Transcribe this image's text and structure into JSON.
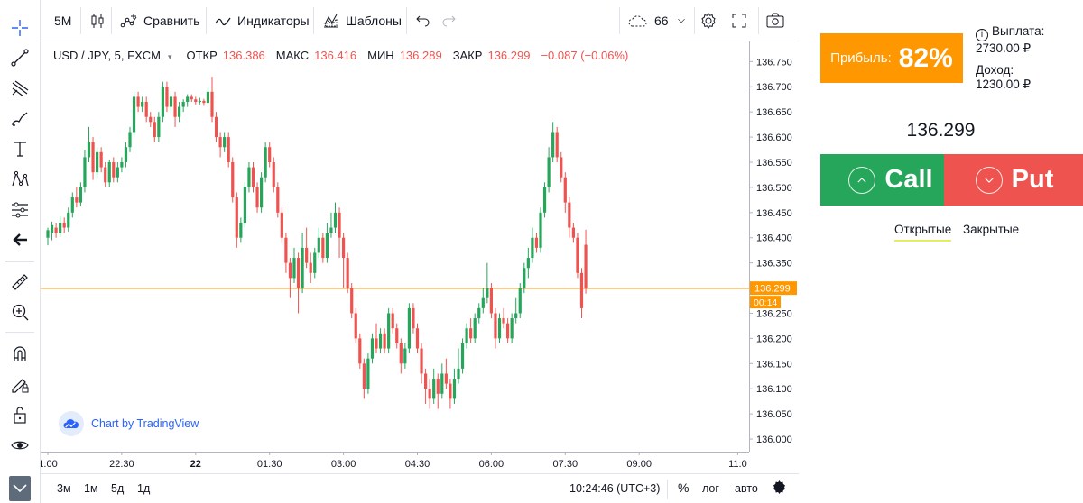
{
  "top_toolbar": {
    "interval": "5M",
    "compare_label": "Сравнить",
    "indicators_label": "Индикаторы",
    "templates_label": "Шаблоны",
    "weather_count": "66"
  },
  "legend": {
    "symbol": "USD / JPY, 5, FXCM",
    "open_label": "ОТКР",
    "open": "136.386",
    "high_label": "МАКС",
    "high": "136.416",
    "low_label": "МИН",
    "low": "136.289",
    "close_label": "ЗАКР",
    "close": "136.299",
    "change": "−0.087 (−0.06%)"
  },
  "price_label": {
    "price": "136.299",
    "countdown": "00:14"
  },
  "watermark": "Chart by TradingView",
  "bottom_bar": {
    "ranges": [
      "3м",
      "1м",
      "5д",
      "1д"
    ],
    "time": "10:24:46 (UTC+3)",
    "percent": "%",
    "log": "лог",
    "auto": "авто"
  },
  "right_panel": {
    "profit_label": "Прибыль:",
    "profit_value": "82%",
    "payout_label": "Выплата:",
    "payout_value": "2730.00 ₽",
    "income_label": "Доход:",
    "income_value": "1230.00 ₽",
    "current_price": "136.299",
    "call_label": "Call",
    "put_label": "Put",
    "tab_open": "Открытые",
    "tab_closed": "Закрытые"
  },
  "colors": {
    "up": "#26a65b",
    "down": "#ef5350",
    "accent": "#ff9800",
    "brand": "#2962ff"
  },
  "chart_data": {
    "type": "candlestick",
    "y_ticks": [
      "136.750",
      "136.700",
      "136.650",
      "136.600",
      "136.550",
      "136.500",
      "136.450",
      "136.400",
      "136.350",
      "136.300",
      "136.250",
      "136.200",
      "136.150",
      "136.100",
      "136.050",
      "136.000"
    ],
    "ylim": [
      135.975,
      136.79
    ],
    "x_ticks": [
      {
        "label": "1:00",
        "bold": false,
        "i": 0
      },
      {
        "label": "22:30",
        "bold": false,
        "i": 18
      },
      {
        "label": "22",
        "bold": true,
        "i": 36
      },
      {
        "label": "01:30",
        "bold": false,
        "i": 54
      },
      {
        "label": "03:00",
        "bold": false,
        "i": 72
      },
      {
        "label": "04:30",
        "bold": false,
        "i": 90
      },
      {
        "label": "06:00",
        "bold": false,
        "i": 108
      },
      {
        "label": "07:30",
        "bold": false,
        "i": 126
      },
      {
        "label": "09:00",
        "bold": false,
        "i": 144
      },
      {
        "label": "11:0",
        "bold": false,
        "i": 168
      }
    ],
    "current_price": 136.299,
    "candles": [
      [
        136.4,
        136.415,
        136.385,
        136.42
      ],
      [
        136.41,
        136.425,
        136.395,
        136.432
      ],
      [
        136.42,
        136.41,
        136.4,
        136.43
      ],
      [
        136.41,
        136.43,
        136.402,
        136.442
      ],
      [
        136.43,
        136.42,
        136.41,
        136.44
      ],
      [
        136.42,
        136.45,
        136.412,
        136.46
      ],
      [
        136.45,
        136.48,
        136.44,
        136.49
      ],
      [
        136.48,
        136.47,
        136.46,
        136.5
      ],
      [
        136.47,
        136.5,
        136.462,
        136.51
      ],
      [
        136.5,
        136.56,
        136.49,
        136.575
      ],
      [
        136.56,
        136.59,
        136.55,
        136.62
      ],
      [
        136.59,
        136.53,
        136.515,
        136.6
      ],
      [
        136.53,
        136.57,
        136.52,
        136.58
      ],
      [
        136.57,
        136.54,
        136.53,
        136.58
      ],
      [
        136.54,
        136.51,
        136.5,
        136.55
      ],
      [
        136.51,
        136.55,
        136.5,
        136.555
      ],
      [
        136.55,
        136.52,
        136.51,
        136.56
      ],
      [
        136.52,
        136.54,
        136.51,
        136.55
      ],
      [
        136.54,
        136.55,
        136.53,
        136.56
      ],
      [
        136.55,
        136.58,
        136.54,
        136.59
      ],
      [
        136.58,
        136.61,
        136.57,
        136.62
      ],
      [
        136.61,
        136.68,
        136.6,
        136.69
      ],
      [
        136.68,
        136.66,
        136.65,
        136.69
      ],
      [
        136.66,
        136.67,
        136.65,
        136.68
      ],
      [
        136.67,
        136.64,
        136.63,
        136.68
      ],
      [
        136.64,
        136.63,
        136.62,
        136.65
      ],
      [
        136.63,
        136.6,
        136.59,
        136.64
      ],
      [
        136.6,
        136.64,
        136.59,
        136.65
      ],
      [
        136.64,
        136.7,
        136.63,
        136.71
      ],
      [
        136.7,
        136.66,
        136.65,
        136.71
      ],
      [
        136.66,
        136.68,
        136.65,
        136.69
      ],
      [
        136.68,
        136.64,
        136.62,
        136.69
      ],
      [
        136.64,
        136.66,
        136.63,
        136.67
      ],
      [
        136.66,
        136.67,
        136.65,
        136.675
      ],
      [
        136.67,
        136.68,
        136.66,
        136.685
      ],
      [
        136.68,
        136.675,
        136.67,
        136.685
      ],
      [
        136.675,
        136.67,
        136.665,
        136.68
      ],
      [
        136.67,
        136.672,
        136.665,
        136.678
      ],
      [
        136.672,
        136.668,
        136.662,
        136.676
      ],
      [
        136.668,
        136.69,
        136.665,
        136.7
      ],
      [
        136.69,
        136.64,
        136.63,
        136.72
      ],
      [
        136.64,
        136.6,
        136.59,
        136.65
      ],
      [
        136.6,
        136.58,
        136.56,
        136.61
      ],
      [
        136.58,
        136.6,
        136.57,
        136.61
      ],
      [
        136.6,
        136.55,
        136.54,
        136.61
      ],
      [
        136.55,
        136.48,
        136.47,
        136.56
      ],
      [
        136.48,
        136.4,
        136.38,
        136.49
      ],
      [
        136.4,
        136.43,
        136.39,
        136.44
      ],
      [
        136.43,
        136.5,
        136.42,
        136.51
      ],
      [
        136.5,
        136.54,
        136.49,
        136.55
      ],
      [
        136.54,
        136.5,
        136.49,
        136.55
      ],
      [
        136.5,
        136.46,
        136.45,
        136.51
      ],
      [
        136.46,
        136.52,
        136.45,
        136.53
      ],
      [
        136.52,
        136.58,
        136.51,
        136.59
      ],
      [
        136.58,
        136.55,
        136.54,
        136.59
      ],
      [
        136.55,
        136.5,
        136.49,
        136.56
      ],
      [
        136.5,
        136.45,
        136.44,
        136.51
      ],
      [
        136.45,
        136.4,
        136.39,
        136.46
      ],
      [
        136.4,
        136.35,
        136.33,
        136.41
      ],
      [
        136.35,
        136.32,
        136.28,
        136.36
      ],
      [
        136.32,
        136.36,
        136.31,
        136.38
      ],
      [
        136.36,
        136.3,
        136.25,
        136.37
      ],
      [
        136.3,
        136.38,
        136.29,
        136.41
      ],
      [
        136.38,
        136.35,
        136.34,
        136.42
      ],
      [
        136.35,
        136.33,
        136.31,
        136.37
      ],
      [
        136.33,
        136.37,
        136.32,
        136.38
      ],
      [
        136.37,
        136.4,
        136.36,
        136.42
      ],
      [
        136.4,
        136.36,
        136.35,
        136.41
      ],
      [
        136.36,
        136.41,
        136.35,
        136.43
      ],
      [
        136.41,
        136.42,
        136.4,
        136.45
      ],
      [
        136.42,
        136.45,
        136.41,
        136.47
      ],
      [
        136.45,
        136.4,
        136.36,
        136.46
      ],
      [
        136.4,
        136.36,
        136.3,
        136.41
      ],
      [
        136.36,
        136.3,
        136.29,
        136.37
      ],
      [
        136.3,
        136.25,
        136.24,
        136.31
      ],
      [
        136.25,
        136.2,
        136.19,
        136.26
      ],
      [
        136.2,
        136.15,
        136.14,
        136.21
      ],
      [
        136.15,
        136.1,
        136.08,
        136.16
      ],
      [
        136.1,
        136.16,
        136.09,
        136.17
      ],
      [
        136.16,
        136.2,
        136.15,
        136.21
      ],
      [
        136.2,
        136.18,
        136.17,
        136.23
      ],
      [
        136.18,
        136.21,
        136.17,
        136.22
      ],
      [
        136.21,
        136.18,
        136.17,
        136.22
      ],
      [
        136.18,
        136.25,
        136.17,
        136.26
      ],
      [
        136.25,
        136.22,
        136.21,
        136.26
      ],
      [
        136.22,
        136.19,
        136.18,
        136.23
      ],
      [
        136.19,
        136.15,
        136.13,
        136.2
      ],
      [
        136.15,
        136.18,
        136.14,
        136.19
      ],
      [
        136.18,
        136.26,
        136.17,
        136.27
      ],
      [
        136.26,
        136.22,
        136.21,
        136.27
      ],
      [
        136.22,
        136.18,
        136.17,
        136.23
      ],
      [
        136.18,
        136.13,
        136.11,
        136.19
      ],
      [
        136.13,
        136.1,
        136.07,
        136.14
      ],
      [
        136.1,
        136.08,
        136.06,
        136.12
      ],
      [
        136.08,
        136.12,
        136.07,
        136.14
      ],
      [
        136.12,
        136.09,
        136.06,
        136.13
      ],
      [
        136.09,
        136.13,
        136.08,
        136.15
      ],
      [
        136.13,
        136.11,
        136.1,
        136.16
      ],
      [
        136.11,
        136.08,
        136.06,
        136.12
      ],
      [
        136.08,
        136.12,
        136.07,
        136.14
      ],
      [
        136.12,
        136.14,
        136.11,
        136.18
      ],
      [
        136.14,
        136.19,
        136.13,
        136.2
      ],
      [
        136.19,
        136.22,
        136.18,
        136.23
      ],
      [
        136.22,
        136.2,
        136.19,
        136.24
      ],
      [
        136.2,
        136.24,
        136.19,
        136.25
      ],
      [
        136.24,
        136.26,
        136.23,
        136.27
      ],
      [
        136.26,
        136.28,
        136.25,
        136.3
      ],
      [
        136.28,
        136.3,
        136.27,
        136.35
      ],
      [
        136.3,
        136.25,
        136.24,
        136.31
      ],
      [
        136.25,
        136.2,
        136.18,
        136.26
      ],
      [
        136.2,
        136.24,
        136.19,
        136.25
      ],
      [
        136.24,
        136.23,
        136.22,
        136.26
      ],
      [
        136.23,
        136.2,
        136.19,
        136.24
      ],
      [
        136.2,
        136.24,
        136.19,
        136.25
      ],
      [
        136.24,
        136.25,
        136.23,
        136.28
      ],
      [
        136.25,
        136.3,
        136.24,
        136.31
      ],
      [
        136.3,
        136.34,
        136.29,
        136.35
      ],
      [
        136.34,
        136.36,
        136.32,
        136.38
      ],
      [
        136.36,
        136.4,
        136.35,
        136.42
      ],
      [
        136.4,
        136.38,
        136.37,
        136.41
      ],
      [
        136.38,
        136.45,
        136.37,
        136.46
      ],
      [
        136.45,
        136.5,
        136.44,
        136.51
      ],
      [
        136.5,
        136.56,
        136.49,
        136.58
      ],
      [
        136.56,
        136.61,
        136.55,
        136.63
      ],
      [
        136.61,
        136.56,
        136.55,
        136.62
      ],
      [
        136.56,
        136.52,
        136.51,
        136.57
      ],
      [
        136.52,
        136.47,
        136.45,
        136.53
      ],
      [
        136.47,
        136.42,
        136.4,
        136.48
      ],
      [
        136.42,
        136.4,
        136.39,
        136.43
      ],
      [
        136.4,
        136.33,
        136.32,
        136.41
      ],
      [
        136.33,
        136.26,
        136.24,
        136.34
      ],
      [
        136.386,
        136.299,
        136.289,
        136.416
      ]
    ]
  }
}
